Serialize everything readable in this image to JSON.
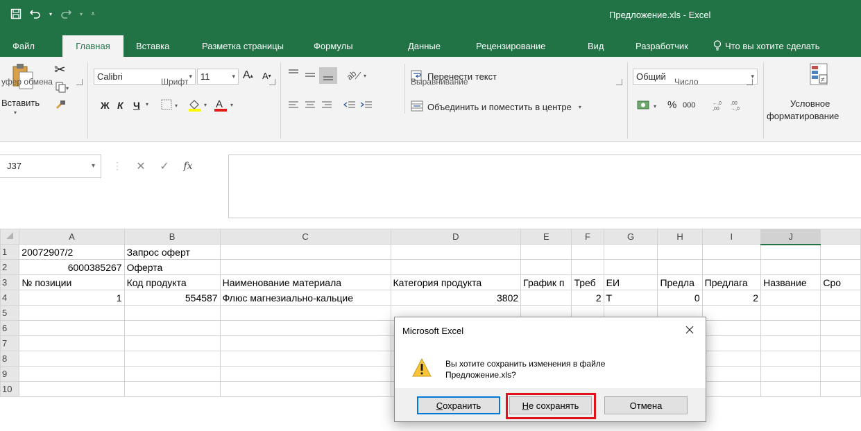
{
  "window": {
    "title": "Предложение.xls - Excel"
  },
  "tabs": [
    {
      "label": "Файл"
    },
    {
      "label": "Главная"
    },
    {
      "label": "Вставка"
    },
    {
      "label": "Разметка страницы"
    },
    {
      "label": "Формулы"
    },
    {
      "label": "Данные"
    },
    {
      "label": "Рецензирование"
    },
    {
      "label": "Вид"
    },
    {
      "label": "Разработчик"
    },
    {
      "label": "Что вы хотите сделать"
    }
  ],
  "ribbon": {
    "clipboard": {
      "paste_label": "Вставить",
      "group_label": "уфер обмена"
    },
    "font": {
      "name": "Calibri",
      "size": "11",
      "bold": "Ж",
      "italic": "К",
      "underline": "Ч",
      "group_label": "Шрифт"
    },
    "alignment": {
      "wrap_text": "Перенести текст",
      "merge_center": "Объединить и поместить в центре",
      "group_label": "Выравнивание"
    },
    "number": {
      "format": "Общий",
      "percent": "%",
      "thousands": "000",
      "group_label": "Число"
    },
    "styles": {
      "conditional_formatting_line1": "Условное",
      "conditional_formatting_line2": "форматирование"
    }
  },
  "formula_bar": {
    "name_box": "J37",
    "fx": "fx",
    "value": ""
  },
  "sheet": {
    "columns": [
      "A",
      "B",
      "C",
      "D",
      "E",
      "F",
      "G",
      "H",
      "I",
      "J"
    ],
    "rows": [
      {
        "num": "1",
        "cells": [
          "20072907/2",
          "Запрос оферт",
          "",
          "",
          "",
          "",
          "",
          "",
          "",
          ""
        ]
      },
      {
        "num": "2",
        "cells": [
          "6000385267",
          "Оферта",
          "",
          "",
          "",
          "",
          "",
          "",
          "",
          ""
        ]
      },
      {
        "num": "3",
        "cells": [
          "№ позиции",
          "Код продукта",
          "Наименование материала",
          "Категория продукта",
          "График п",
          "Треб",
          "ЕИ",
          "Предла",
          "Предлага",
          "Название",
          "Сро"
        ]
      },
      {
        "num": "4",
        "cells": [
          "1",
          "554587",
          "Флюс магнезиально-кальцие",
          "3802",
          "",
          "2",
          "Т",
          "0",
          "2",
          ""
        ]
      },
      {
        "num": "5",
        "cells": [
          "",
          "",
          "",
          "",
          "",
          "",
          "",
          "",
          "",
          ""
        ]
      },
      {
        "num": "6",
        "cells": [
          "",
          "",
          "",
          "",
          "",
          "",
          "",
          "",
          "",
          ""
        ]
      },
      {
        "num": "7",
        "cells": [
          "",
          "",
          "",
          "",
          "",
          "",
          "",
          "",
          "",
          ""
        ]
      },
      {
        "num": "8",
        "cells": [
          "",
          "",
          "",
          "",
          "",
          "",
          "",
          "",
          "",
          ""
        ]
      },
      {
        "num": "9",
        "cells": [
          "",
          "",
          "",
          "",
          "",
          "",
          "",
          "",
          "",
          ""
        ]
      },
      {
        "num": "10",
        "cells": [
          "",
          "",
          "",
          "",
          "",
          "",
          "",
          "",
          "",
          ""
        ]
      }
    ]
  },
  "dialog": {
    "title": "Microsoft Excel",
    "message_line1": "Вы хотите сохранить изменения в файле",
    "message_line2": "Предложение.xls?",
    "save_label_accel": "С",
    "save_label_rest": "охранить",
    "dont_save_label_accel": "Н",
    "dont_save_label_rest": "е сохранять",
    "cancel_label": "Отмена"
  },
  "colors": {
    "excel_green": "#217346",
    "highlight_red": "#e0121c",
    "default_button_border": "#0078d7"
  }
}
